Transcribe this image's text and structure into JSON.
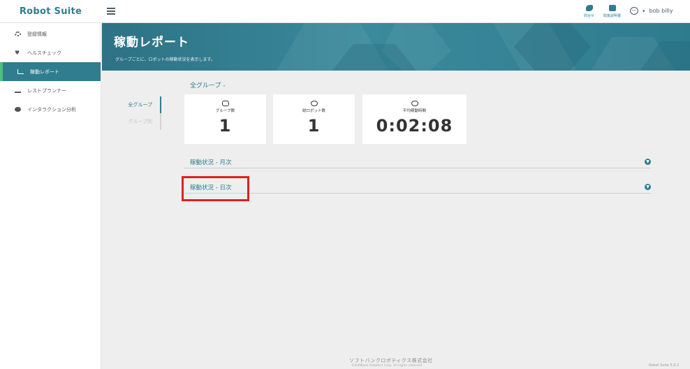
{
  "app": {
    "brand": "Robot Suite"
  },
  "topbar": {
    "inquiry_label": "問合せ",
    "manual_label": "取扱説明書",
    "username": "bob billy",
    "caret": "▾"
  },
  "sidebar": {
    "items": [
      {
        "label": "登録情報",
        "icon": "gear-icon"
      },
      {
        "label": "ヘルスチェック",
        "icon": "heart-icon"
      },
      {
        "label": "稼動レポート",
        "icon": "chart-icon",
        "active": true
      },
      {
        "label": "レストプランナー",
        "icon": "bed-icon"
      },
      {
        "label": "インタラクション分析",
        "icon": "pie-icon"
      }
    ]
  },
  "hero": {
    "title": "稼動レポート",
    "subtitle": "グループごとに、ロボットの稼動状況を表示します。"
  },
  "group_tabs": [
    {
      "label": "全グループ",
      "active": true
    },
    {
      "label": "グループ別",
      "active": false
    }
  ],
  "section": {
    "title": "全グループ -"
  },
  "cards": [
    {
      "label": "グループ数",
      "value": "1",
      "icon": "group-icon"
    },
    {
      "label": "総ロボット数",
      "value": "1",
      "icon": "robot-icon"
    },
    {
      "label": "平均稼動時間",
      "value": "0:02:08",
      "icon": "clock-icon"
    }
  ],
  "accordions": [
    {
      "label": "稼動状況 - 月次"
    },
    {
      "label": "稼動状況 - 日次"
    }
  ],
  "footer": {
    "company": "ソフトバンクロボティクス株式会社",
    "copyright": "©SoftBank Robotics Corp. All rights reserved.",
    "version": "Robot Suite 5.0.2"
  },
  "colors": {
    "accent": "#2f7d8f",
    "active_bar": "#4cbf78",
    "highlight": "#e02020"
  }
}
